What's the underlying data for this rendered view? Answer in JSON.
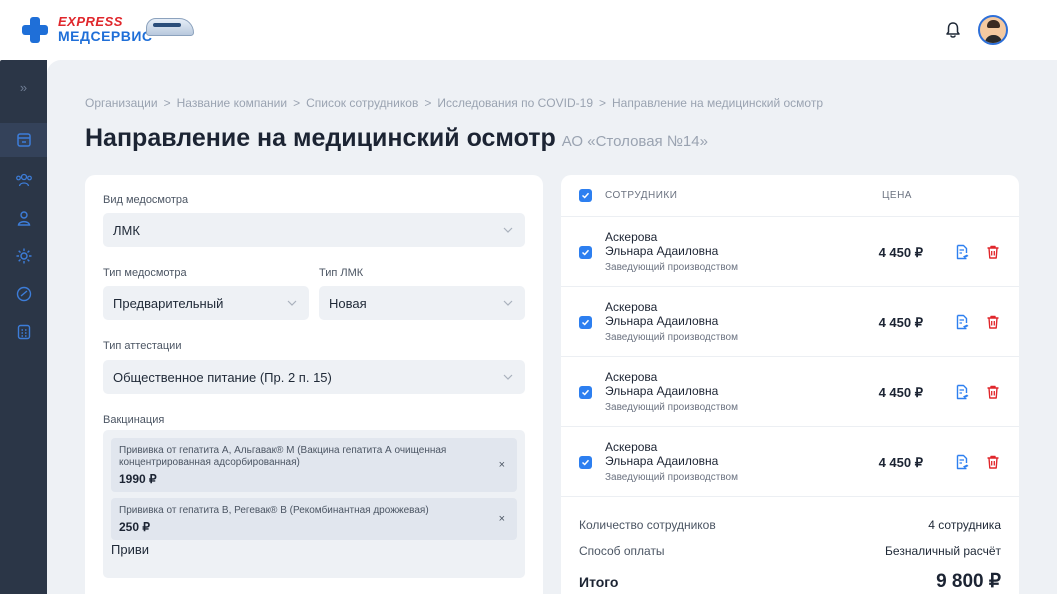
{
  "brand": {
    "line1": "EXPRESS",
    "line2": "МЕДСЕРВИС"
  },
  "colors": {
    "accent": "#2d7ff0",
    "danger": "#e0262b",
    "sidebar": "#2b3647",
    "background": "#eef1f5"
  },
  "sidebar": {
    "items": [
      "expand-icon",
      "store-icon",
      "users-icon",
      "user-icon",
      "settings-icon",
      "gauge-icon",
      "calculator-icon"
    ]
  },
  "breadcrumb": [
    "Организации",
    "Название компании",
    "Список сотрудников",
    "Исследования по COVID-19",
    "Направление на медицинский осмотр"
  ],
  "breadcrumb_sep": ">",
  "page": {
    "title": "Направление на медицинский осмотр",
    "subtitle": "АО «Столовая №14»"
  },
  "form": {
    "exam_kind_label": "Вид медосмотра",
    "exam_kind_value": "ЛМК",
    "exam_type_label": "Тип медосмотра",
    "exam_type_value": "Предварительный",
    "lmk_type_label": "Тип ЛМК",
    "lmk_type_value": "Новая",
    "attestation_label": "Тип аттестации",
    "attestation_value": "Общественное питание (Пр. 2 п. 15)",
    "vaccination_label": "Вакцинация",
    "vaccinations": [
      {
        "name": "Прививка от гепатита А, Альгавак® М (Вакцина гепатита А очищенная концентрированная адсорбированная)",
        "price": "1990 ₽"
      },
      {
        "name": "Прививка от гепатита В, Регевак® В (Рекомбинантная дрожжевая)",
        "price": "250 ₽"
      }
    ],
    "vaccination_input": "Приви",
    "remove_symbol": "×"
  },
  "employees": {
    "header": {
      "name": "СОТРУДНИКИ",
      "price": "ЦЕНА"
    },
    "rows": [
      {
        "surname": "Аскерова",
        "name": "Эльнара Адаиловна",
        "position": "Заведующий производством",
        "price": "4 450 ₽"
      },
      {
        "surname": "Аскерова",
        "name": "Эльнара Адаиловна",
        "position": "Заведующий производством",
        "price": "4 450 ₽"
      },
      {
        "surname": "Аскерова",
        "name": "Эльнара Адаиловна",
        "position": "Заведующий производством",
        "price": "4 450 ₽"
      },
      {
        "surname": "Аскерова",
        "name": "Эльнара Адаиловна",
        "position": "Заведующий производством",
        "price": "4 450 ₽"
      }
    ]
  },
  "summary": {
    "count_label": "Количество сотрудников",
    "count_value": "4 сотрудника",
    "payment_label": "Способ оплаты",
    "payment_value": "Безналичный расчёт",
    "total_label": "Итого",
    "total_value": "9 800 ₽"
  }
}
